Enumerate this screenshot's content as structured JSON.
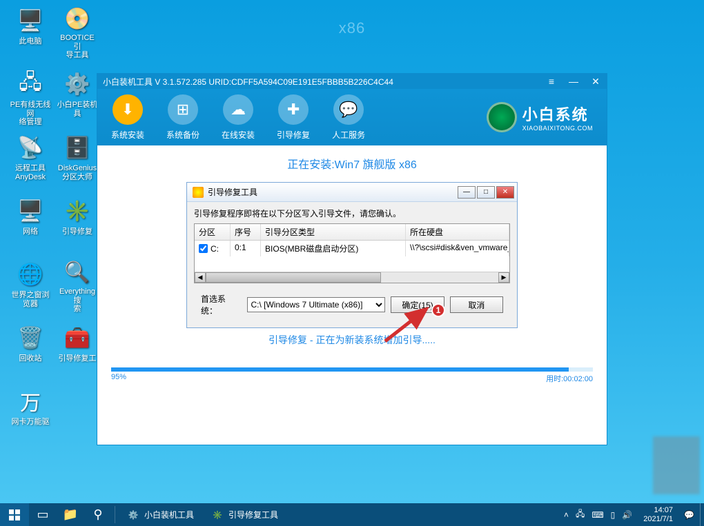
{
  "watermark": "x86",
  "desktop_icons": [
    {
      "label": "此电脑",
      "glyph": "🖥️"
    },
    {
      "label": "PE有线无线网\n络管理",
      "glyph": "🖧"
    },
    {
      "label": "远程工具\nAnyDesk",
      "glyph": "📡"
    },
    {
      "label": "网络",
      "glyph": "🖥️"
    },
    {
      "label": "世界之窗浏\n览器",
      "glyph": "🌐"
    },
    {
      "label": "回收站",
      "glyph": "🗑️"
    },
    {
      "label": "网卡万能驱",
      "glyph": "万"
    },
    {
      "label": "BOOTICE引\n导工具",
      "glyph": "📀"
    },
    {
      "label": "小白PE装机\n具",
      "glyph": "⚙️"
    },
    {
      "label": "DiskGenius\n分区大师",
      "glyph": "🗄️"
    },
    {
      "label": "引导修复",
      "glyph": "✳️"
    },
    {
      "label": "Everything搜\n索",
      "glyph": "🔍"
    },
    {
      "label": "引导修复工",
      "glyph": "🧰"
    }
  ],
  "app": {
    "title": "小白装机工具 V 3.1.572.285 URID:CDFF5A594C09E191E5FBBB5B226C4C44",
    "toolbar": [
      {
        "label": "系统安装",
        "glyph": "⬇"
      },
      {
        "label": "系统备份",
        "glyph": "⊞"
      },
      {
        "label": "在线安装",
        "glyph": "☁"
      },
      {
        "label": "引导修复",
        "glyph": "✚"
      },
      {
        "label": "人工服务",
        "glyph": "💬"
      }
    ],
    "brand_big": "小白系统",
    "brand_small": "XIAOBAIXITONG.COM",
    "install_title": "正在安装:Win7 旗舰版 x86",
    "status_line": "引导修复 - 正在为新装系统增加引导.....",
    "progress_pct": "95%",
    "progress_fill": "95%",
    "time_label": "用时:",
    "time_value": "00:02:00"
  },
  "dlg": {
    "title": "引导修复工具",
    "message": "引导修复程序即将在以下分区写入引导文件，请您确认。",
    "headers": {
      "part": "分区",
      "seq": "序号",
      "type": "引导分区类型",
      "disk": "所在硬盘"
    },
    "rows": [
      {
        "checked": true,
        "part": "C:",
        "seq": "0:1",
        "type": "BIOS(MBR磁盘启动分区)",
        "disk": "\\\\?\\scsi#disk&ven_vmware_&"
      }
    ],
    "select_label": "首选系统：",
    "select_value": "C:\\ [Windows 7 Ultimate (x86)]",
    "ok_label": "确定(15)",
    "cancel_label": "取消"
  },
  "annotation_badge": "1",
  "taskbar": {
    "apps": [
      {
        "label": "小白装机工具",
        "glyph": "⚙️"
      },
      {
        "label": "引导修复工具",
        "glyph": "✳️"
      }
    ],
    "clock_time": "14:07",
    "clock_date": "2021/7/1"
  }
}
